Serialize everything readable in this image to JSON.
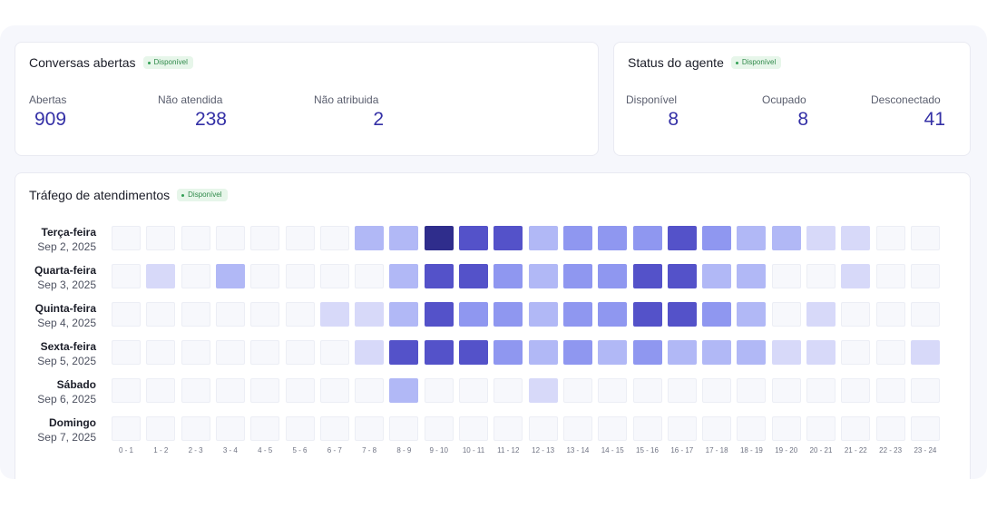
{
  "cards": {
    "open": {
      "title": "Conversas abertas",
      "badge": "Disponível",
      "metrics": [
        {
          "label": "Abertas",
          "value": "909"
        },
        {
          "label": "Não atendida",
          "value": "238"
        },
        {
          "label": "Não atribuida",
          "value": "2"
        }
      ]
    },
    "agent": {
      "title": "Status do agente",
      "badge": "Disponível",
      "metrics": [
        {
          "label": "Disponível",
          "value": "8"
        },
        {
          "label": "Ocupado",
          "value": "8"
        },
        {
          "label": "Desconectado",
          "value": "41"
        }
      ]
    },
    "traffic": {
      "title": "Tráfego de atendimentos",
      "badge": "Disponível"
    }
  },
  "colors": {
    "accent": "#3430a6",
    "badge_bg": "#e7f6ea",
    "badge_text": "#2f8a4a",
    "level_colors": [
      "#f7f8fc",
      "#d7d9f9",
      "#b1b8f6",
      "#8f97f0",
      "#5452c9",
      "#2f2d8c"
    ]
  },
  "heatmap": {
    "days": [
      {
        "name": "Terça-feira",
        "date": "Sep 2, 2025"
      },
      {
        "name": "Quarta-feira",
        "date": "Sep 3, 2025"
      },
      {
        "name": "Quinta-feira",
        "date": "Sep 4, 2025"
      },
      {
        "name": "Sexta-feira",
        "date": "Sep 5, 2025"
      },
      {
        "name": "Sábado",
        "date": "Sep 6, 2025"
      },
      {
        "name": "Domingo",
        "date": "Sep 7, 2025"
      }
    ],
    "hours": [
      "0 - 1",
      "1 - 2",
      "2 - 3",
      "3 - 4",
      "4 - 5",
      "5 - 6",
      "6 - 7",
      "7 - 8",
      "8 - 9",
      "9 - 10",
      "10 - 11",
      "11 - 12",
      "12 - 13",
      "13 - 14",
      "14 - 15",
      "15 - 16",
      "16 - 17",
      "17 - 18",
      "18 - 19",
      "19 - 20",
      "20 - 21",
      "21 - 22",
      "22 - 23",
      "23 - 24"
    ],
    "levels": [
      [
        0,
        0,
        0,
        0,
        0,
        0,
        0,
        2,
        2,
        5,
        4,
        4,
        2,
        3,
        3,
        3,
        4,
        3,
        2,
        2,
        1,
        1,
        0,
        0
      ],
      [
        0,
        1,
        0,
        2,
        0,
        0,
        0,
        0,
        2,
        4,
        4,
        3,
        2,
        3,
        3,
        4,
        4,
        2,
        2,
        0,
        0,
        1,
        0,
        0
      ],
      [
        0,
        0,
        0,
        0,
        0,
        0,
        1,
        1,
        2,
        4,
        3,
        3,
        2,
        3,
        3,
        4,
        4,
        3,
        2,
        0,
        1,
        0,
        0,
        0
      ],
      [
        0,
        0,
        0,
        0,
        0,
        0,
        0,
        1,
        4,
        4,
        4,
        3,
        2,
        3,
        2,
        3,
        2,
        2,
        2,
        1,
        1,
        0,
        0,
        1
      ],
      [
        0,
        0,
        0,
        0,
        0,
        0,
        0,
        0,
        2,
        0,
        0,
        0,
        1,
        0,
        0,
        0,
        0,
        0,
        0,
        0,
        0,
        0,
        0,
        0
      ],
      [
        0,
        0,
        0,
        0,
        0,
        0,
        0,
        0,
        0,
        0,
        0,
        0,
        0,
        0,
        0,
        0,
        0,
        0,
        0,
        0,
        0,
        0,
        0,
        0
      ]
    ]
  }
}
